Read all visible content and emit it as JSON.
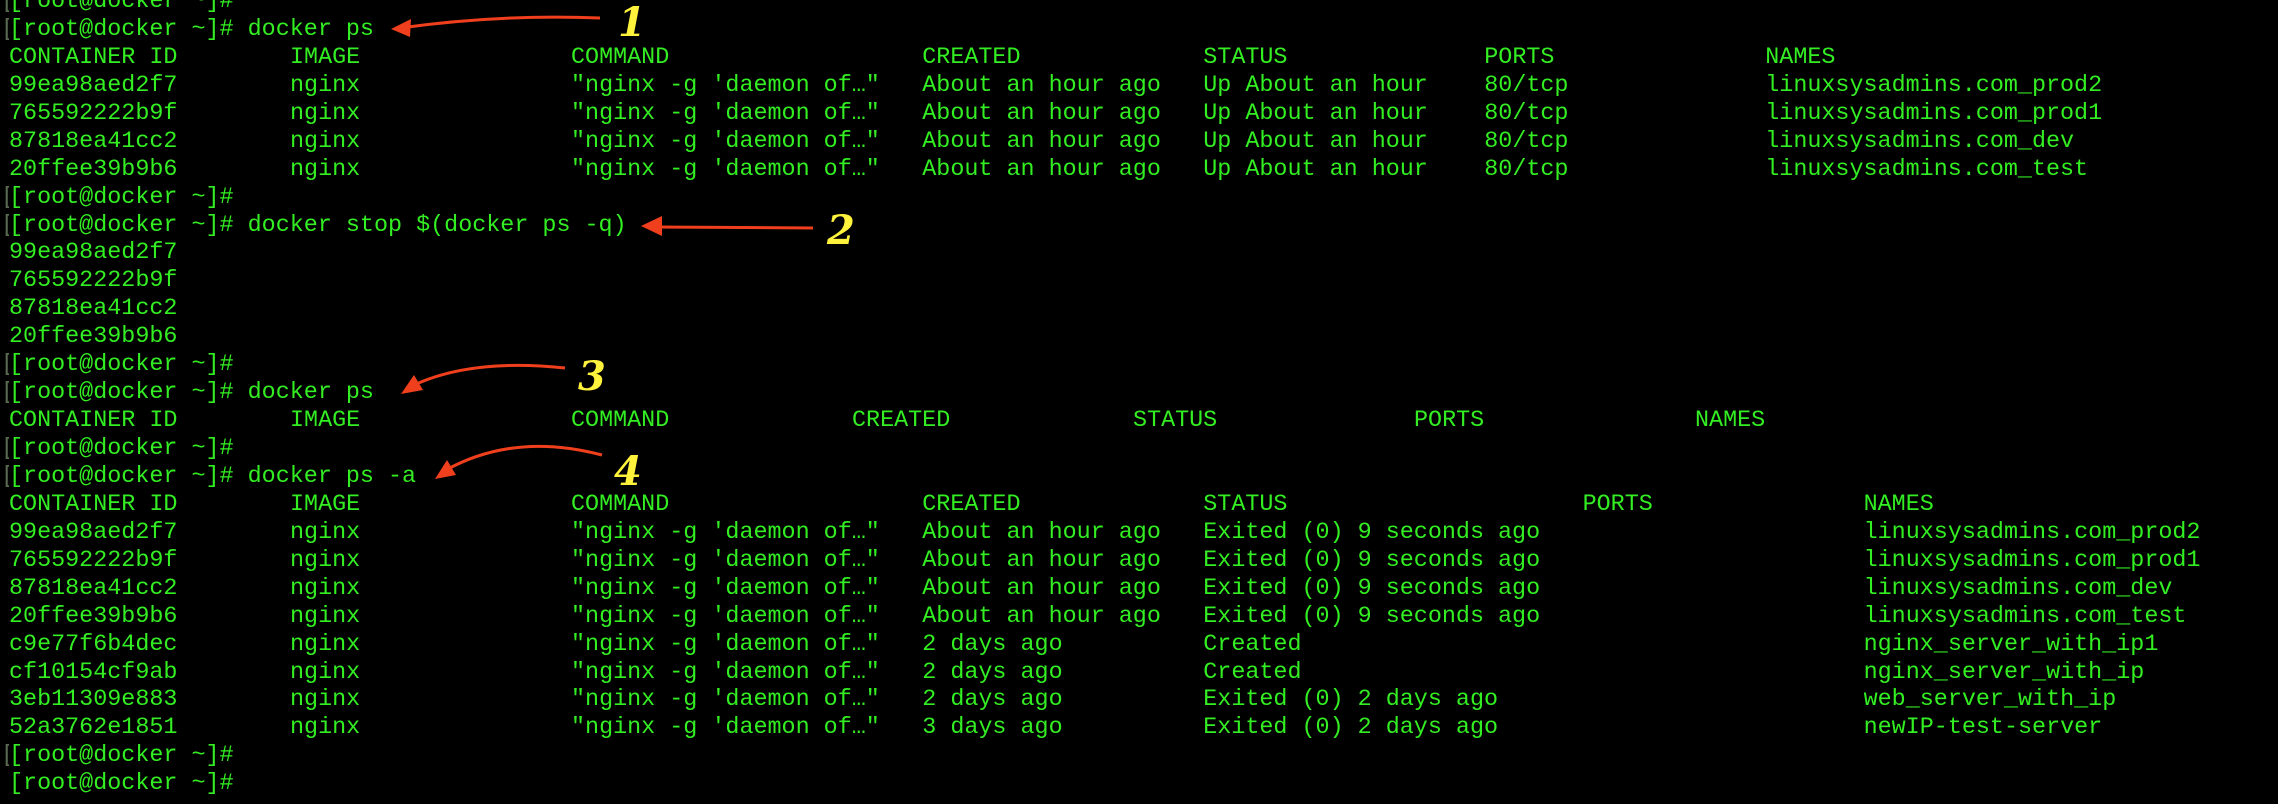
{
  "terminal": {
    "prompt": "[root@docker ~]#",
    "colors": {
      "text": "#33ee22",
      "arrow": "#ef3f1d",
      "label": "#fff23c",
      "background": "#000000"
    },
    "sessions": [
      {
        "command": "docker ps",
        "annotation": "1",
        "table": {
          "headers": [
            "CONTAINER ID",
            "IMAGE",
            "COMMAND",
            "CREATED",
            "STATUS",
            "PORTS",
            "NAMES"
          ],
          "rows": [
            [
              "99ea98aed2f7",
              "nginx",
              "\"nginx -g 'daemon of…\"",
              "About an hour ago",
              "Up About an hour",
              "80/tcp",
              "linuxsysadmins.com_prod2"
            ],
            [
              "765592222b9f",
              "nginx",
              "\"nginx -g 'daemon of…\"",
              "About an hour ago",
              "Up About an hour",
              "80/tcp",
              "linuxsysadmins.com_prod1"
            ],
            [
              "87818ea41cc2",
              "nginx",
              "\"nginx -g 'daemon of…\"",
              "About an hour ago",
              "Up About an hour",
              "80/tcp",
              "linuxsysadmins.com_dev"
            ],
            [
              "20ffee39b9b6",
              "nginx",
              "\"nginx -g 'daemon of…\"",
              "About an hour ago",
              "Up About an hour",
              "80/tcp",
              "linuxsysadmins.com_test"
            ]
          ]
        }
      },
      {
        "command": "docker stop $(docker ps -q)",
        "annotation": "2",
        "output": [
          "99ea98aed2f7",
          "765592222b9f",
          "87818ea41cc2",
          "20ffee39b9b6"
        ]
      },
      {
        "command": "docker ps",
        "annotation": "3",
        "table": {
          "headers": [
            "CONTAINER ID",
            "IMAGE",
            "COMMAND",
            "CREATED",
            "STATUS",
            "PORTS",
            "NAMES"
          ],
          "rows": []
        }
      },
      {
        "command": "docker ps -a",
        "annotation": "4",
        "table": {
          "headers": [
            "CONTAINER ID",
            "IMAGE",
            "COMMAND",
            "CREATED",
            "STATUS",
            "PORTS",
            "NAMES"
          ],
          "rows": [
            [
              "99ea98aed2f7",
              "nginx",
              "\"nginx -g 'daemon of…\"",
              "About an hour ago",
              "Exited (0) 9 seconds ago",
              "",
              "linuxsysadmins.com_prod2"
            ],
            [
              "765592222b9f",
              "nginx",
              "\"nginx -g 'daemon of…\"",
              "About an hour ago",
              "Exited (0) 9 seconds ago",
              "",
              "linuxsysadmins.com_prod1"
            ],
            [
              "87818ea41cc2",
              "nginx",
              "\"nginx -g 'daemon of…\"",
              "About an hour ago",
              "Exited (0) 9 seconds ago",
              "",
              "linuxsysadmins.com_dev"
            ],
            [
              "20ffee39b9b6",
              "nginx",
              "\"nginx -g 'daemon of…\"",
              "About an hour ago",
              "Exited (0) 9 seconds ago",
              "",
              "linuxsysadmins.com_test"
            ],
            [
              "c9e77f6b4dec",
              "nginx",
              "\"nginx -g 'daemon of…\"",
              "2 days ago",
              "Created",
              "",
              "nginx_server_with_ip1"
            ],
            [
              "cf10154cf9ab",
              "nginx",
              "\"nginx -g 'daemon of…\"",
              "2 days ago",
              "Created",
              "",
              "nginx_server_with_ip"
            ],
            [
              "3eb11309e883",
              "nginx",
              "\"nginx -g 'daemon of…\"",
              "2 days ago",
              "Exited (0) 2 days ago",
              "",
              "web_server_with_ip"
            ],
            [
              "52a3762e1851",
              "nginx",
              "\"nginx -g 'daemon of…\"",
              "3 days ago",
              "Exited (0) 2 days ago",
              "",
              "newIP-test-server"
            ]
          ]
        }
      }
    ]
  }
}
